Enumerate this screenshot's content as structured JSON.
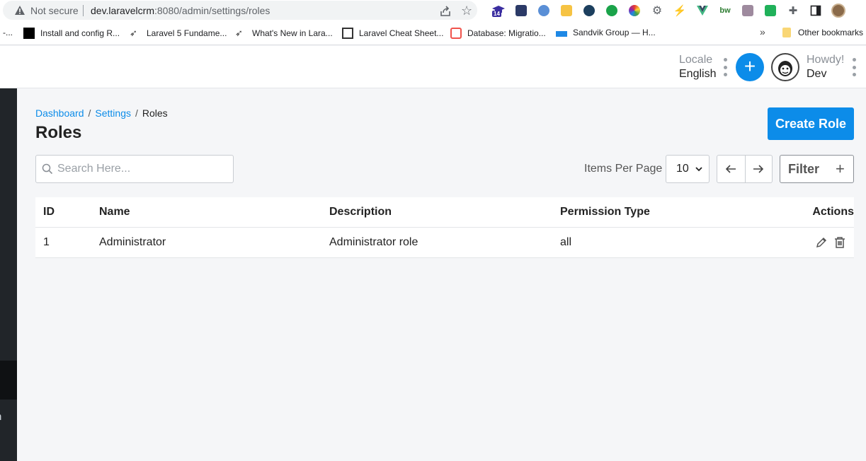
{
  "browser": {
    "security_label": "Not secure",
    "url_host": "dev.laravelcrm",
    "url_path": ":8080/admin/settings/roles",
    "extension_badge": "14",
    "bookmarks": [
      {
        "label": "-..."
      },
      {
        "label": "Install and config R..."
      },
      {
        "label": "Laravel 5 Fundame..."
      },
      {
        "label": "What's New in Lara..."
      },
      {
        "label": "Laravel Cheat Sheet..."
      },
      {
        "label": "Database: Migratio..."
      },
      {
        "label": "Sandvik Group — H..."
      }
    ],
    "more_bookmarks": "»",
    "other_bookmarks": "Other bookmarks"
  },
  "header": {
    "locale_label": "Locale",
    "locale_value": "English",
    "add_symbol": "+",
    "howdy": "Howdy!",
    "user_name": "Dev"
  },
  "sidebar": {
    "partial_text": "n"
  },
  "page": {
    "breadcrumb": {
      "dashboard": "Dashboard",
      "settings": "Settings",
      "current": "Roles",
      "separator": "/"
    },
    "title": "Roles",
    "create_button": "Create Role"
  },
  "toolbar": {
    "search_placeholder": "Search Here...",
    "items_per_page_label": "Items Per Page",
    "items_per_page_value": "10",
    "filter_label": "Filter",
    "filter_symbol": "+"
  },
  "table": {
    "headers": {
      "id": "ID",
      "name": "Name",
      "description": "Description",
      "permission_type": "Permission Type",
      "actions": "Actions"
    },
    "rows": [
      {
        "id": "1",
        "name": "Administrator",
        "description": "Administrator role",
        "permission_type": "all"
      }
    ]
  },
  "colors": {
    "accent": "#0c8ce9",
    "sidebar": "#212529",
    "background": "#f5f6f8"
  }
}
